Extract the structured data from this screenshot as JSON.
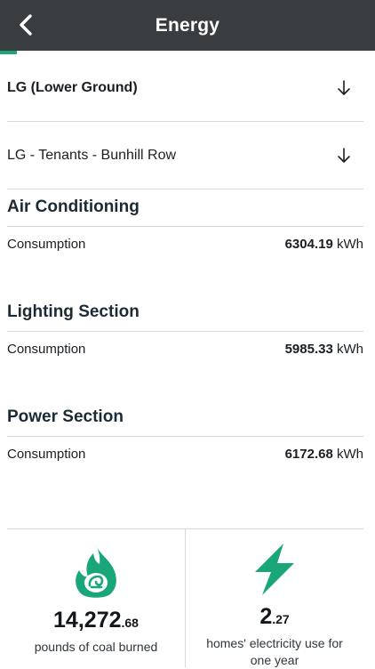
{
  "header": {
    "title": "Energy",
    "progress_fraction": 0.045,
    "accent": "#19a67a"
  },
  "filters": [
    {
      "label": "LG (Lower Ground)",
      "icon": "arrow-down-icon"
    },
    {
      "label": "LG - Tenants - Bunhill Row",
      "icon": "arrow-down-icon"
    }
  ],
  "sections": [
    {
      "title": "Air Conditioning",
      "row_label": "Consumption",
      "value": "6304.19",
      "unit": "kWh"
    },
    {
      "title": "Lighting Section",
      "row_label": "Consumption",
      "value": "5985.33",
      "unit": "kWh"
    },
    {
      "title": "Power Section",
      "row_label": "Consumption",
      "value": "6172.68",
      "unit": "kWh"
    }
  ],
  "stats": [
    {
      "icon": "coal-flame-icon",
      "value_int": "14,272",
      "value_dec": ".68",
      "caption": "pounds of coal burned"
    },
    {
      "icon": "lightning-bolt-icon",
      "value_int": "2",
      "value_dec": ".27",
      "caption": "homes' electricity use for one year"
    }
  ]
}
